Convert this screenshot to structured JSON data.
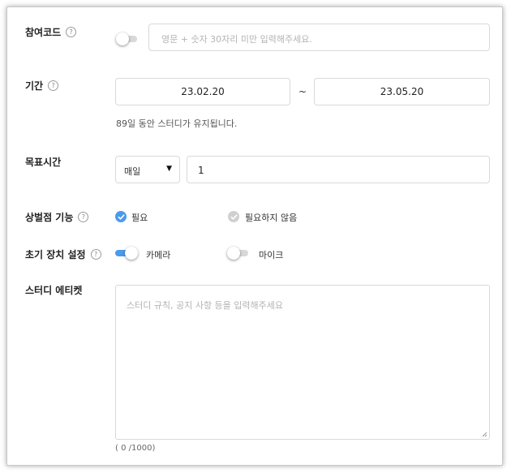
{
  "code": {
    "label": "참여코드",
    "help": "?",
    "placeholder": "영문 + 숫자 30자리 미만 입력해주세요."
  },
  "period": {
    "label": "기간",
    "help": "?",
    "start": "23.02.20",
    "separator": "~",
    "end": "23.05.20",
    "note": "89일 동안 스터디가 유지됩니다."
  },
  "goal": {
    "label": "목표시간",
    "select_value": "매일",
    "select_arrow": "▼",
    "value": "1"
  },
  "penalty": {
    "label": "상벌점 기능",
    "help": "?",
    "option_required": "필요",
    "option_not_required": "필요하지 않음"
  },
  "device": {
    "label": "초기 장치 설정",
    "help": "?",
    "camera_label": "카메라",
    "mic_label": "마이크"
  },
  "etiquette": {
    "label": "스터디 에티켓",
    "placeholder": "스터디 규칙, 공지 사항 등을 입력해주세요",
    "counter": "( 0 /1000)"
  },
  "colors": {
    "accent": "#4c9aec",
    "border": "#d9d9d9",
    "check_off": "#d0d0d0"
  }
}
